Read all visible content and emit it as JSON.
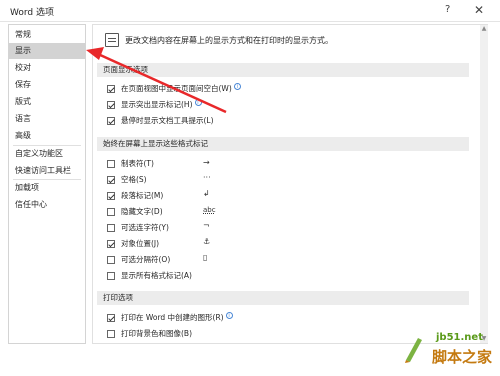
{
  "window": {
    "title": "Word 选项",
    "help_glyph": "?",
    "close_glyph": "✕"
  },
  "sidebar": {
    "items": [
      {
        "label": "常规",
        "selected": false
      },
      {
        "label": "显示",
        "selected": true
      },
      {
        "label": "校对",
        "selected": false
      },
      {
        "label": "保存",
        "selected": false
      },
      {
        "label": "版式",
        "selected": false
      },
      {
        "label": "语言",
        "selected": false
      },
      {
        "label": "高级",
        "selected": false
      },
      {
        "label": "自定义功能区",
        "selected": false
      },
      {
        "label": "快速访问工具栏",
        "selected": false
      },
      {
        "label": "加载项",
        "selected": false
      },
      {
        "label": "信任中心",
        "selected": false
      }
    ]
  },
  "main": {
    "intro": "更改文档内容在屏幕上的显示方式和在打印时的显示方式。",
    "sections": {
      "page_display": {
        "header": "页面显示选项",
        "options": [
          {
            "label": "在页面视图中显示页面间空白(W)",
            "checked": true,
            "info": true
          },
          {
            "label": "显示突出显示标记(H)",
            "checked": true,
            "info": true
          },
          {
            "label": "悬停时显示文档工具提示(L)",
            "checked": true,
            "info": false
          }
        ]
      },
      "formatting_marks": {
        "header": "始终在屏幕上显示这些格式标记",
        "options": [
          {
            "label": "制表符(T)",
            "checked": false,
            "mark": "→"
          },
          {
            "label": "空格(S)",
            "checked": true,
            "mark": "···"
          },
          {
            "label": "段落标记(M)",
            "checked": true,
            "mark": "↲"
          },
          {
            "label": "隐藏文字(D)",
            "checked": false,
            "mark": "abc"
          },
          {
            "label": "可选连字符(Y)",
            "checked": false,
            "mark": "¬"
          },
          {
            "label": "对象位置(J)",
            "checked": true,
            "mark": "⚓"
          },
          {
            "label": "可选分隔符(O)",
            "checked": false,
            "mark": "▯"
          },
          {
            "label": "显示所有格式标记(A)",
            "checked": false,
            "mark": ""
          }
        ]
      },
      "print": {
        "header": "打印选项",
        "options": [
          {
            "label": "打印在 Word 中创建的图形(R)",
            "checked": true,
            "info": true
          },
          {
            "label": "打印背景色和图像(B)",
            "checked": false,
            "info": false
          }
        ]
      }
    }
  },
  "scroll": {
    "up_glyph": "▲",
    "down_glyph": "▼"
  },
  "watermark": {
    "line1": "jb51.net",
    "line2": "脚本之家"
  },
  "colors": {
    "annotation_arrow": "#e8282a",
    "selected_nav": "#d3d3d3",
    "section_header": "#ececec"
  }
}
